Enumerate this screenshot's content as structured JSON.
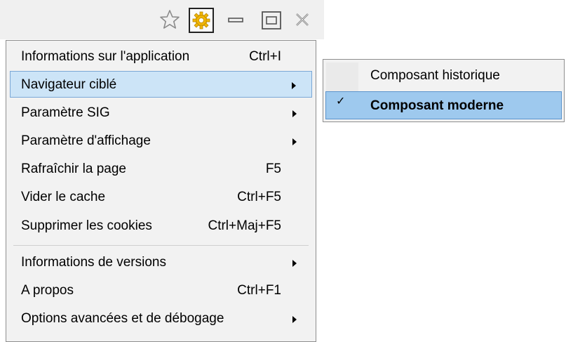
{
  "toolbar": {
    "icons": [
      "star-icon",
      "gear-icon",
      "minimize-icon",
      "maximize-icon",
      "close-icon"
    ],
    "gear_color": "#f2b705"
  },
  "menu": {
    "items": [
      {
        "label": "Informations sur l'application",
        "shortcut": "Ctrl+I",
        "submenu": false
      },
      {
        "label": "Navigateur ciblé",
        "shortcut": "",
        "submenu": true,
        "highlighted": true
      },
      {
        "label": "Paramètre SIG",
        "shortcut": "",
        "submenu": true
      },
      {
        "label": "Paramètre d'affichage",
        "shortcut": "",
        "submenu": true
      },
      {
        "label": "Rafraîchir la page",
        "shortcut": "F5",
        "submenu": false
      },
      {
        "label": "Vider le cache",
        "shortcut": "Ctrl+F5",
        "submenu": false
      },
      {
        "label": "Supprimer les cookies",
        "shortcut": "Ctrl+Maj+F5",
        "submenu": false
      },
      {
        "label": "Informations de versions",
        "shortcut": "",
        "submenu": true
      },
      {
        "label": "A propos",
        "shortcut": "Ctrl+F1",
        "submenu": false
      },
      {
        "label": "Options avancées et de débogage",
        "shortcut": "",
        "submenu": true
      }
    ]
  },
  "submenu": {
    "items": [
      {
        "label": "Composant historique",
        "checked": false
      },
      {
        "label": "Composant moderne",
        "checked": true,
        "check_mark": "✓"
      }
    ]
  },
  "colors": {
    "highlight": "#cce4f7",
    "selected": "#9ec9ee"
  }
}
